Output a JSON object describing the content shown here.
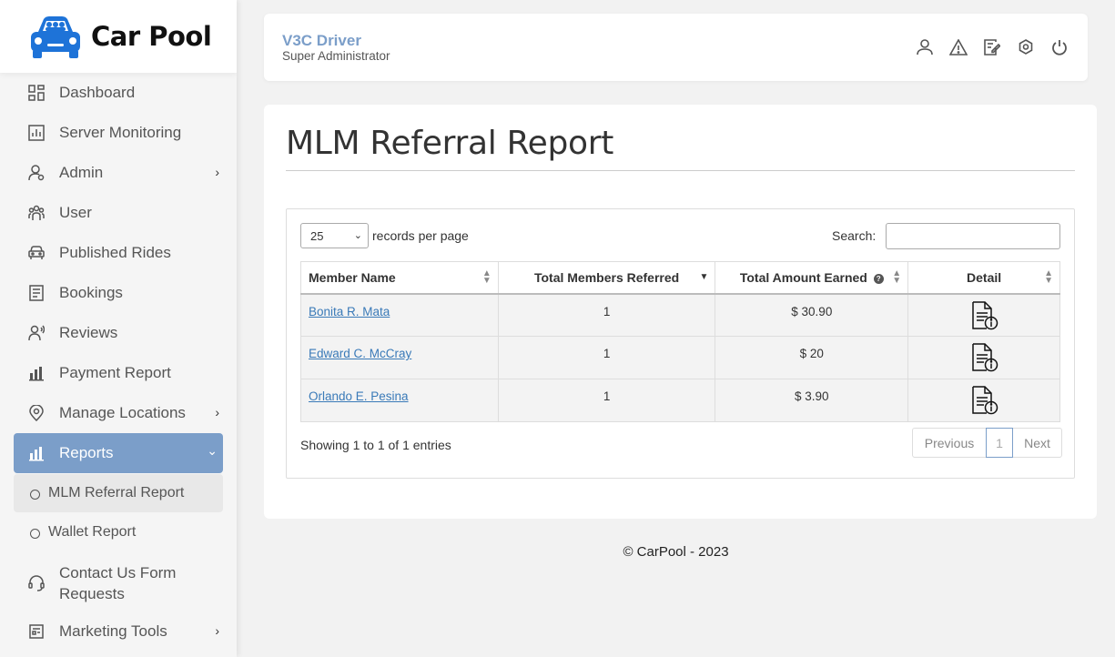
{
  "brand": {
    "name": "Car Pool"
  },
  "sidebar": {
    "items": [
      {
        "label": "Dashboard",
        "icon": "dashboard-icon"
      },
      {
        "label": "Server Monitoring",
        "icon": "chart-icon"
      },
      {
        "label": "Admin",
        "icon": "admin-icon",
        "has_children": true
      },
      {
        "label": "User",
        "icon": "users-icon"
      },
      {
        "label": "Published Rides",
        "icon": "car-icon"
      },
      {
        "label": "Bookings",
        "icon": "list-icon"
      },
      {
        "label": "Reviews",
        "icon": "reviews-icon"
      },
      {
        "label": "Payment Report",
        "icon": "bar-chart-icon"
      },
      {
        "label": "Manage Locations",
        "icon": "location-icon",
        "has_children": true
      },
      {
        "label": "Reports",
        "icon": "reports-icon",
        "has_children": true,
        "active": true
      },
      {
        "label": "Contact Us Form Requests",
        "icon": "headset-icon"
      },
      {
        "label": "Marketing Tools",
        "icon": "marketing-icon",
        "has_children": true
      }
    ],
    "sub_items": [
      {
        "label": "MLM Referral Report",
        "active": true
      },
      {
        "label": "Wallet Report"
      }
    ]
  },
  "header": {
    "user_name": "V3C Driver",
    "user_role": "Super Administrator"
  },
  "main": {
    "title": "MLM Referral Report",
    "length_value": "25",
    "length_label": "records per page",
    "search_label": "Search:",
    "search_value": "",
    "columns": [
      "Member Name",
      "Total Members Referred",
      "Total Amount Earned",
      "Detail"
    ],
    "rows": [
      {
        "name": "Bonita R. Mata",
        "referred": "1",
        "earned": "$ 30.90"
      },
      {
        "name": "Edward C. McCray",
        "referred": "1",
        "earned": "$ 20"
      },
      {
        "name": "Orlando E. Pesina",
        "referred": "1",
        "earned": "$ 3.90"
      }
    ],
    "info": "Showing 1 to 1 of 1 entries",
    "pager": {
      "previous": "Previous",
      "current": "1",
      "next": "Next"
    }
  },
  "footer": {
    "text": "© CarPool - 2023"
  },
  "colors": {
    "accent": "#7b9ec9",
    "link": "#3a7ab8"
  }
}
